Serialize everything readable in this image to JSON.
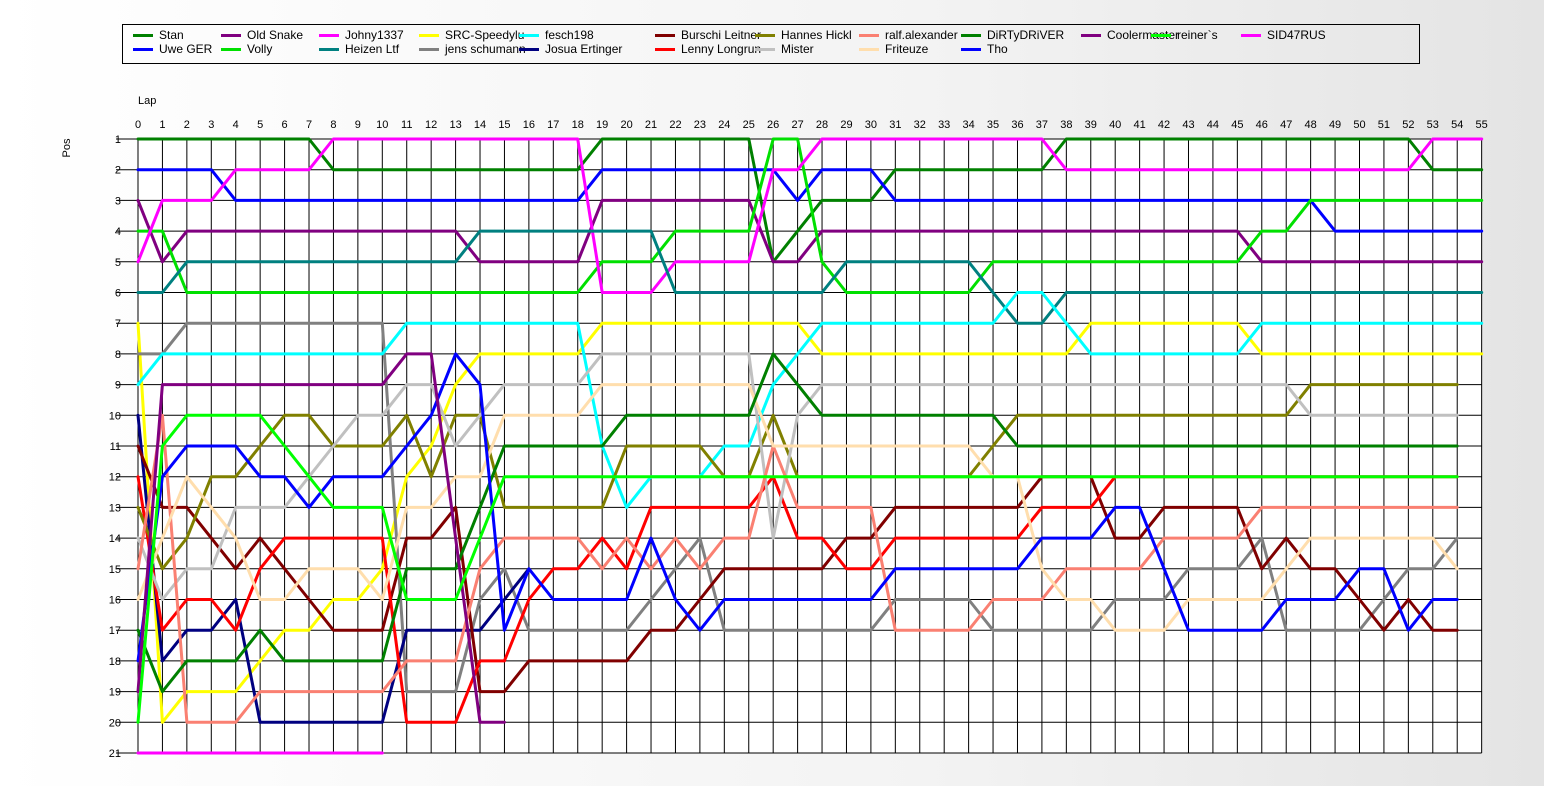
{
  "chart_data": {
    "type": "line",
    "xlabel": "Lap",
    "ylabel": "Pos",
    "xlim": [
      0,
      55
    ],
    "ylim": [
      1,
      21
    ],
    "y_inverted": true,
    "grid": true,
    "legend_position": "top",
    "x_ticks": [
      0,
      1,
      2,
      3,
      4,
      5,
      6,
      7,
      8,
      9,
      10,
      11,
      12,
      13,
      14,
      15,
      16,
      17,
      18,
      19,
      20,
      21,
      22,
      23,
      24,
      25,
      26,
      27,
      28,
      29,
      30,
      31,
      32,
      33,
      34,
      35,
      36,
      37,
      38,
      39,
      40,
      41,
      42,
      43,
      44,
      45,
      46,
      47,
      48,
      49,
      50,
      51,
      52,
      53,
      54,
      55
    ],
    "y_ticks": [
      1,
      2,
      3,
      4,
      5,
      6,
      7,
      8,
      9,
      10,
      11,
      12,
      13,
      14,
      15,
      16,
      17,
      18,
      19,
      20,
      21
    ],
    "series": [
      {
        "name": "Stan",
        "color": "#008000",
        "y": [
          1,
          1,
          1,
          1,
          1,
          1,
          1,
          1,
          2,
          2,
          2,
          2,
          2,
          2,
          2,
          2,
          2,
          2,
          2,
          1,
          1,
          1,
          1,
          1,
          1,
          1,
          5,
          4,
          3,
          3,
          3,
          2,
          2,
          2,
          2,
          2,
          2,
          2,
          1,
          1,
          1,
          1,
          1,
          1,
          1,
          1,
          1,
          1,
          1,
          1,
          1,
          1,
          1,
          2,
          2,
          2
        ]
      },
      {
        "name": "Uwe GER",
        "color": "#0000FF",
        "y": [
          2,
          2,
          2,
          2,
          3,
          3,
          3,
          3,
          3,
          3,
          3,
          3,
          3,
          3,
          3,
          3,
          3,
          3,
          3,
          2,
          2,
          2,
          2,
          2,
          2,
          2,
          2,
          3,
          2,
          2,
          2,
          3,
          3,
          3,
          3,
          3,
          3,
          3,
          3,
          3,
          3,
          3,
          3,
          3,
          3,
          3,
          3,
          3,
          3,
          4,
          4,
          4,
          4,
          4,
          4,
          4
        ]
      },
      {
        "name": "Old Snake",
        "color": "#800080",
        "y": [
          3,
          5,
          4,
          4,
          4,
          4,
          4,
          4,
          4,
          4,
          4,
          4,
          4,
          4,
          5,
          5,
          5,
          5,
          5,
          3,
          3,
          3,
          3,
          3,
          3,
          3,
          5,
          5,
          4,
          4,
          4,
          4,
          4,
          4,
          4,
          4,
          4,
          4,
          4,
          4,
          4,
          4,
          4,
          4,
          4,
          4,
          5,
          5,
          5,
          5,
          5,
          5,
          5,
          5,
          5,
          5
        ]
      },
      {
        "name": "Volly",
        "color": "#00E000",
        "y": [
          4,
          4,
          6,
          6,
          6,
          6,
          6,
          6,
          6,
          6,
          6,
          6,
          6,
          6,
          6,
          6,
          6,
          6,
          6,
          5,
          5,
          5,
          4,
          4,
          4,
          4,
          1,
          1,
          5,
          6,
          6,
          6,
          6,
          6,
          6,
          5,
          5,
          5,
          5,
          5,
          5,
          5,
          5,
          5,
          5,
          5,
          4,
          4,
          3,
          3,
          3,
          3,
          3,
          3,
          3,
          3
        ]
      },
      {
        "name": "Johny1337",
        "color": "#FF00FF",
        "y": [
          5,
          3,
          3,
          3,
          2,
          2,
          2,
          2,
          1,
          1,
          1,
          1,
          1,
          1,
          1,
          1,
          1,
          1,
          1,
          6,
          6,
          6,
          5,
          5,
          5,
          5,
          2,
          2,
          1,
          1,
          1,
          1,
          1,
          1,
          1,
          1,
          1,
          1,
          2,
          2,
          2,
          2,
          2,
          2,
          2,
          2,
          2,
          2,
          2,
          2,
          2,
          2,
          2,
          1,
          1,
          1
        ]
      },
      {
        "name": "Heizen Ltf",
        "color": "#008080",
        "y": [
          6,
          6,
          5,
          5,
          5,
          5,
          5,
          5,
          5,
          5,
          5,
          5,
          5,
          5,
          4,
          4,
          4,
          4,
          4,
          4,
          4,
          4,
          6,
          6,
          6,
          6,
          6,
          6,
          6,
          5,
          5,
          5,
          5,
          5,
          5,
          6,
          7,
          7,
          6,
          6,
          6,
          6,
          6,
          6,
          6,
          6,
          6,
          6,
          6,
          6,
          6,
          6,
          6,
          6,
          6,
          6
        ]
      },
      {
        "name": "SRC-Speedylu",
        "color": "#FFFF00",
        "y": [
          7,
          20,
          19,
          19,
          19,
          18,
          17,
          17,
          16,
          16,
          15,
          12,
          11,
          9,
          8,
          8,
          8,
          8,
          8,
          7,
          7,
          7,
          7,
          7,
          7,
          7,
          7,
          7,
          8,
          8,
          8,
          8,
          8,
          8,
          8,
          8,
          8,
          8,
          8,
          7,
          7,
          7,
          7,
          7,
          7,
          7,
          8,
          8,
          8,
          8,
          8,
          8,
          8,
          8,
          8,
          8
        ]
      },
      {
        "name": "jens  schumann",
        "color": "#808080",
        "y": [
          8,
          8,
          7,
          7,
          7,
          7,
          7,
          7,
          7,
          7,
          7,
          19,
          19,
          19,
          16,
          15,
          17,
          17,
          17,
          17,
          17,
          16,
          15,
          14,
          17,
          17,
          17,
          17,
          17,
          17,
          17,
          16,
          16,
          16,
          16,
          17,
          17,
          17,
          17,
          17,
          16,
          16,
          16,
          15,
          15,
          15,
          14,
          17,
          17,
          17,
          17,
          16,
          15,
          15,
          14
        ]
      },
      {
        "name": "fesch198",
        "color": "#00FFFF",
        "y": [
          9,
          8,
          8,
          8,
          8,
          8,
          8,
          8,
          8,
          8,
          8,
          7,
          7,
          7,
          7,
          7,
          7,
          7,
          7,
          11,
          13,
          12,
          12,
          12,
          11,
          11,
          9,
          8,
          7,
          7,
          7,
          7,
          7,
          7,
          7,
          7,
          6,
          6,
          7,
          8,
          8,
          8,
          8,
          8,
          8,
          8,
          7,
          7,
          7,
          7,
          7,
          7,
          7,
          7,
          7,
          7
        ]
      },
      {
        "name": "Josua Ertinger",
        "color": "#000080",
        "y": [
          10,
          18,
          17,
          17,
          16,
          20,
          20,
          20,
          20,
          20,
          20,
          17,
          17,
          17,
          17,
          16,
          15
        ]
      },
      {
        "name": "Burschi Leitner",
        "color": "#800000",
        "y": [
          11,
          13,
          13,
          14,
          15,
          14,
          15,
          16,
          17,
          17,
          17,
          14,
          14,
          13,
          19,
          19,
          18,
          18,
          18,
          18,
          18,
          17,
          17,
          16,
          15,
          15,
          15,
          15,
          15,
          14,
          14,
          13,
          13,
          13,
          13,
          13,
          13,
          12,
          12,
          12,
          14,
          14,
          13,
          13,
          13,
          13,
          15,
          14,
          15,
          15,
          16,
          17,
          16,
          17,
          17
        ]
      },
      {
        "name": "Lenny Longrun",
        "color": "#FF0000",
        "y": [
          12,
          17,
          16,
          16,
          17,
          15,
          14,
          14,
          14,
          14,
          14,
          20,
          20,
          20,
          18,
          18,
          16,
          15,
          15,
          14,
          15,
          13,
          13,
          13,
          13,
          13,
          12,
          14,
          14,
          15,
          15,
          14,
          14,
          14,
          14,
          14,
          14,
          13,
          13,
          13,
          12,
          12,
          12,
          12,
          12,
          12,
          12,
          12,
          12,
          12,
          12,
          12,
          12,
          12,
          12
        ]
      },
      {
        "name": "Hannes Hickl",
        "color": "#808000",
        "y": [
          13,
          15,
          14,
          12,
          12,
          11,
          10,
          10,
          11,
          11,
          11,
          10,
          12,
          10,
          10,
          13,
          13,
          13,
          13,
          13,
          11,
          11,
          11,
          11,
          12,
          12,
          10,
          12,
          12,
          12,
          12,
          12,
          12,
          12,
          12,
          11,
          10,
          10,
          10,
          10,
          10,
          10,
          10,
          10,
          10,
          10,
          10,
          10,
          9,
          9,
          9,
          9,
          9,
          9,
          9
        ]
      },
      {
        "name": "Mister",
        "color": "#C0C0C0",
        "y": [
          14,
          16,
          15,
          15,
          13,
          13,
          13,
          12,
          11,
          10,
          10,
          9,
          9,
          11,
          10,
          9,
          9,
          9,
          9,
          8,
          8,
          8,
          8,
          8,
          8,
          8,
          14,
          10,
          9,
          9,
          9,
          9,
          9,
          9,
          9,
          9,
          9,
          9,
          9,
          9,
          9,
          9,
          9,
          9,
          9,
          9,
          9,
          9,
          10,
          10,
          10,
          10,
          10,
          10,
          10
        ]
      },
      {
        "name": "ralf.alexander",
        "color": "#FA8072",
        "y": [
          15,
          10,
          20,
          20,
          20,
          19,
          19,
          19,
          19,
          19,
          19,
          18,
          18,
          18,
          15,
          14,
          14,
          14,
          14,
          15,
          14,
          15,
          14,
          15,
          14,
          14,
          11,
          13,
          13,
          13,
          13,
          17,
          17,
          17,
          17,
          16,
          16,
          16,
          15,
          15,
          15,
          15,
          14,
          14,
          14,
          14,
          13,
          13,
          13,
          13,
          13,
          13,
          13,
          13,
          13
        ]
      },
      {
        "name": "Friteuze",
        "color": "#FFDEAD",
        "y": [
          16,
          14,
          12,
          13,
          14,
          16,
          16,
          15,
          15,
          15,
          16,
          13,
          13,
          12,
          12,
          10,
          10,
          10,
          10,
          9,
          9,
          9,
          9,
          9,
          9,
          9,
          11,
          11,
          11,
          11,
          11,
          11,
          11,
          11,
          11,
          12,
          12,
          15,
          16,
          16,
          17,
          17,
          17,
          16,
          16,
          16,
          16,
          15,
          14,
          14,
          14,
          14,
          14,
          14,
          15
        ]
      },
      {
        "name": "DiRTyDRiVER",
        "color": "#008000",
        "y": [
          17,
          19,
          18,
          18,
          18,
          17,
          18,
          18,
          18,
          18,
          18,
          15,
          15,
          15,
          13,
          11,
          11,
          11,
          11,
          11,
          10,
          10,
          10,
          10,
          10,
          10,
          8,
          9,
          10,
          10,
          10,
          10,
          10,
          10,
          10,
          10,
          11,
          11,
          11,
          11,
          11,
          11,
          11,
          11,
          11,
          11,
          11,
          11,
          11,
          11,
          11,
          11,
          11,
          11,
          11
        ]
      },
      {
        "name": "Tho",
        "color": "#0000FF",
        "y": [
          18,
          12,
          11,
          11,
          11,
          12,
          12,
          13,
          12,
          12,
          12,
          11,
          10,
          8,
          9,
          17,
          15,
          16,
          16,
          16,
          16,
          14,
          16,
          17,
          16,
          16,
          16,
          16,
          16,
          16,
          16,
          15,
          15,
          15,
          15,
          15,
          15,
          14,
          14,
          14,
          13,
          13,
          15,
          17,
          17,
          17,
          17,
          16,
          16,
          16,
          15,
          15,
          17,
          16,
          16
        ]
      },
      {
        "name": "Coolermaster",
        "color": "#800080",
        "y": [
          19,
          9,
          9,
          9,
          9,
          9,
          9,
          9,
          9,
          9,
          9,
          8,
          8,
          14,
          20,
          20
        ]
      },
      {
        "name": "reiner`s",
        "color": "#00FF00",
        "y": [
          20,
          11,
          10,
          10,
          10,
          10,
          11,
          12,
          13,
          13,
          13,
          16,
          16,
          16,
          14,
          12,
          12,
          12,
          12,
          12,
          12,
          12,
          12,
          12,
          12,
          12,
          12,
          12,
          12,
          12,
          12,
          12,
          12,
          12,
          12,
          12,
          12,
          12,
          12,
          12,
          12,
          12,
          12,
          12,
          12,
          12,
          12,
          12,
          12,
          12,
          12,
          12,
          12,
          12,
          12
        ]
      },
      {
        "name": "SID47RUS",
        "color": "#FF00FF",
        "y": [
          21,
          21,
          21,
          21,
          21,
          21,
          21,
          21,
          21,
          21,
          21
        ]
      }
    ]
  }
}
